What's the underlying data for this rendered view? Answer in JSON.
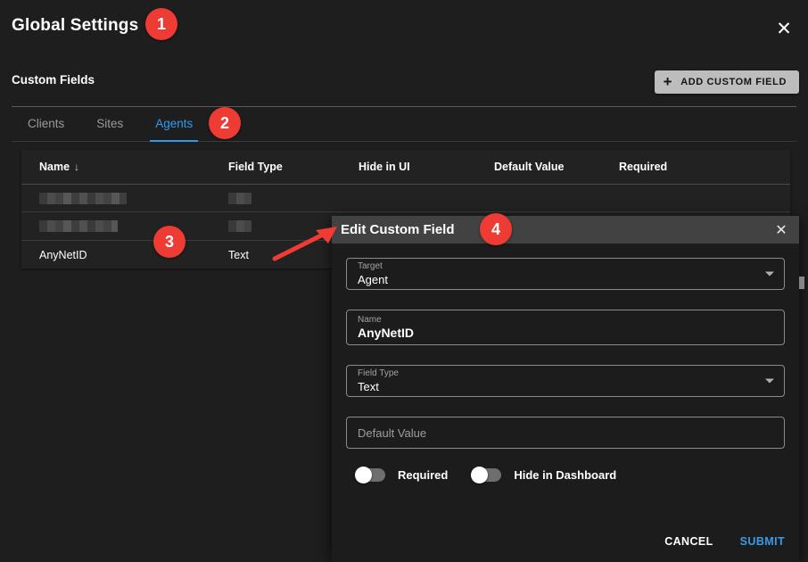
{
  "page": {
    "title": "Global Settings",
    "close_icon": "close-icon",
    "section_title": "Custom Fields",
    "add_button": {
      "label": "ADD CUSTOM FIELD",
      "icon": "plus-icon"
    },
    "accent_color": "#2f9bef",
    "annotation_color": "#ee3b33",
    "background_color": "#1e1e1e"
  },
  "tabs": [
    {
      "label": "Clients",
      "active": false
    },
    {
      "label": "Sites",
      "active": false
    },
    {
      "label": "Agents",
      "active": true
    }
  ],
  "table": {
    "columns": [
      "Name",
      "Field Type",
      "Hide in UI",
      "Default Value",
      "Required"
    ],
    "sort": {
      "column": "Name",
      "direction_icon": "arrow-down-icon"
    },
    "rows": [
      {
        "name": "",
        "field_type": "",
        "hide_in_ui": "",
        "default_value": "",
        "required": "",
        "redacted": true
      },
      {
        "name": "",
        "field_type": "",
        "hide_in_ui": "",
        "default_value": "",
        "required": "",
        "redacted": true
      },
      {
        "name": "AnyNetID",
        "field_type": "Text",
        "hide_in_ui": "",
        "default_value": "",
        "required": "",
        "redacted": false
      }
    ]
  },
  "modal": {
    "title": "Edit Custom Field",
    "close_icon": "close-icon",
    "fields": {
      "target": {
        "label": "Target",
        "value": "Agent",
        "icon": "chevron-down-icon"
      },
      "name": {
        "label": "Name",
        "value": "AnyNetID"
      },
      "field_type": {
        "label": "Field Type",
        "value": "Text",
        "icon": "chevron-down-icon"
      },
      "default_value": {
        "label": "Default Value",
        "placeholder": "Default Value",
        "value": ""
      }
    },
    "toggles": [
      {
        "label": "Required",
        "on": false
      },
      {
        "label": "Hide in Dashboard",
        "on": false
      }
    ],
    "actions": {
      "cancel": "CANCEL",
      "submit": "SUBMIT"
    }
  },
  "annotations": {
    "badges": [
      "1",
      "2",
      "3",
      "4"
    ],
    "arrow": "red-arrow-pointer"
  }
}
